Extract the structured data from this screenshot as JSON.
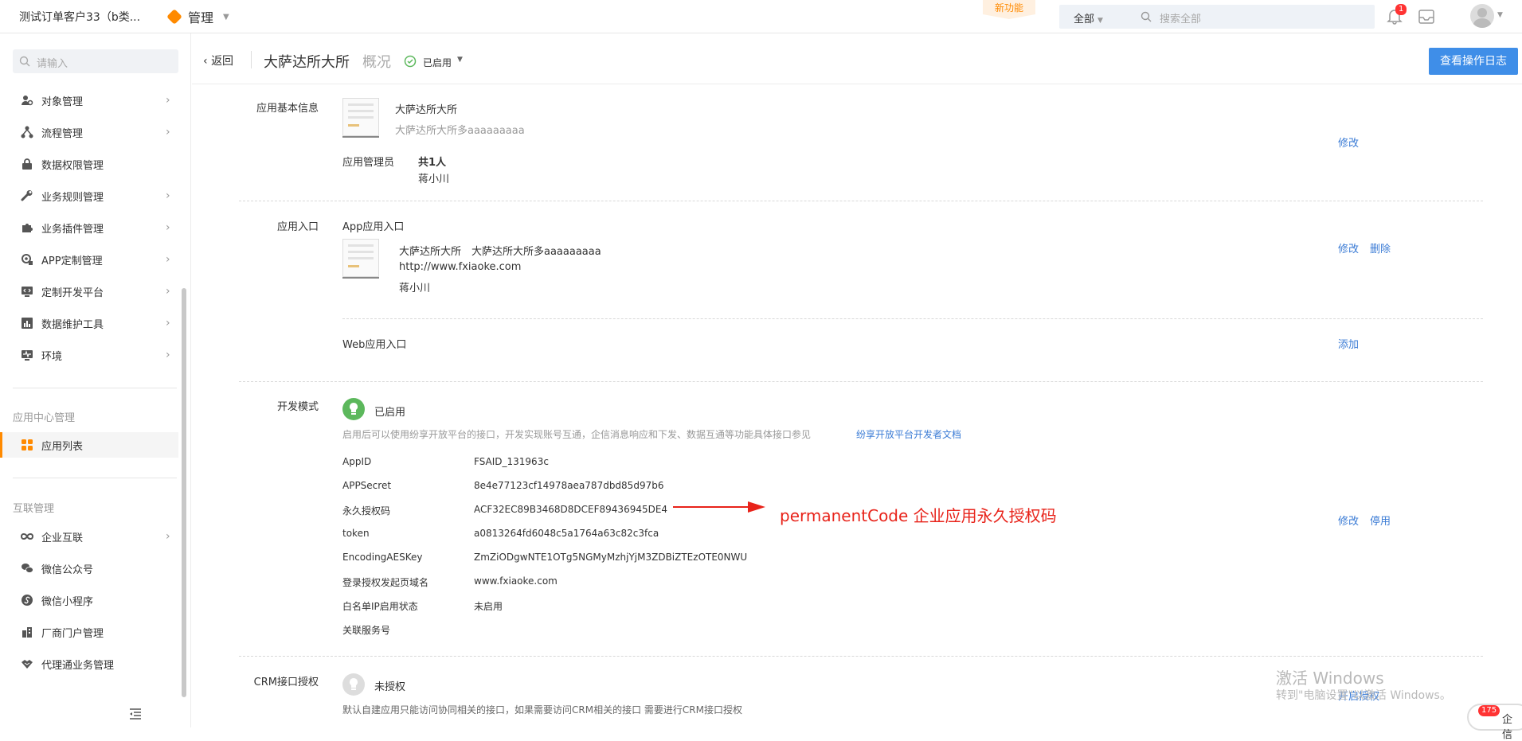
{
  "topbar": {
    "tenant": "测试订单客户33（b类...",
    "manage": "管理",
    "new_feature": "新功能",
    "scope": "全部",
    "search_placeholder": "搜索全部",
    "bell_count": "1"
  },
  "sidebar": {
    "search_placeholder": "请输入",
    "items": [
      {
        "label": "对象管理",
        "icon": "person-gear-icon",
        "chevron": true
      },
      {
        "label": "流程管理",
        "icon": "flow-icon",
        "chevron": true
      },
      {
        "label": "数据权限管理",
        "icon": "lock-icon",
        "chevron": false
      },
      {
        "label": "业务规则管理",
        "icon": "wrench-icon",
        "chevron": true
      },
      {
        "label": "业务插件管理",
        "icon": "puzzle-icon",
        "chevron": true
      },
      {
        "label": "APP定制管理",
        "icon": "app-gear-icon",
        "chevron": true
      },
      {
        "label": "定制开发平台",
        "icon": "code-monitor-icon",
        "chevron": true
      },
      {
        "label": "数据维护工具",
        "icon": "chart-icon",
        "chevron": true
      },
      {
        "label": "环境",
        "icon": "pulse-icon",
        "chevron": true
      }
    ],
    "group_app_center": "应用中心管理",
    "app_list": "应用列表",
    "group_interconnect": "互联管理",
    "items2": [
      {
        "label": "企业互联",
        "icon": "infinity-icon",
        "chevron": true
      },
      {
        "label": "微信公众号",
        "icon": "wechat-icon",
        "chevron": false
      },
      {
        "label": "微信小程序",
        "icon": "miniprogram-icon",
        "chevron": false
      },
      {
        "label": "厂商门户管理",
        "icon": "building-icon",
        "chevron": false
      },
      {
        "label": "代理通业务管理",
        "icon": "handshake-icon",
        "chevron": false
      }
    ]
  },
  "header": {
    "back": "返回",
    "title": "大萨达所大所",
    "overview": "概况",
    "status": "已启用",
    "oplog_button": "查看操作日志"
  },
  "basic": {
    "section": "应用基本信息",
    "name": "大萨达所大所",
    "desc": "大萨达所大所多aaaaaaaaa",
    "admin_label": "应用管理员",
    "admin_count": "共1人",
    "admin_name": "蒋小川",
    "edit": "修改"
  },
  "entry": {
    "section": "应用入口",
    "app_entry": "App应用入口",
    "name": "大萨达所大所",
    "desc": "大萨达所大所多aaaaaaaaa",
    "url": "http://www.fxiaoke.com",
    "owner": "蒋小川",
    "edit": "修改",
    "delete": "删除",
    "web_entry": "Web应用入口",
    "add": "添加"
  },
  "dev": {
    "section": "开发模式",
    "status": "已启用",
    "desc": "启用后可以使用纷享开放平台的接口，开发实现账号互通，企信消息响应和下发、数据互通等功能具体接口参见",
    "doc_link": "纷享开放平台开发者文档",
    "fields": [
      {
        "k": "AppID",
        "v": "FSAID_131963c"
      },
      {
        "k": "APPSecret",
        "v": "8e4e77123cf14978aea787dbd85d97b6"
      },
      {
        "k": "永久授权码",
        "v": "ACF32EC89B3468D8DCEF89436945DE4"
      },
      {
        "k": "token",
        "v": "a0813264fd6048c5a1764a63c82c3fca"
      },
      {
        "k": "EncodingAESKey",
        "v": "ZmZiODgwNTE1OTg5NGMyMzhjYjM3ZDBiZTEzOTE0NWU"
      },
      {
        "k": "登录授权发起页域名",
        "v": "www.fxiaoke.com"
      },
      {
        "k": "白名单IP启用状态",
        "v": "未启用"
      },
      {
        "k": "关联服务号",
        "v": ""
      }
    ],
    "annotation": "permanentCode 企业应用永久授权码",
    "edit": "修改",
    "disable": "停用"
  },
  "crm": {
    "section": "CRM接口授权",
    "status": "未授权",
    "desc": "默认自建应用只能访问协同相关的接口，如果需要访问CRM相关的接口 需要进行CRM接口授权",
    "enable": "开启授权"
  },
  "overlay": {
    "watermark1": "激活 Windows",
    "watermark2": "转到\"电脑设置\"以激活 Windows。",
    "chat_count": "175",
    "chat_label": "企信"
  },
  "colors": {
    "accent": "#ff8a00",
    "primary": "#3f8ee8",
    "link": "#3a7bd5",
    "annotation": "#e8231a",
    "enabled": "#5cb85c"
  }
}
